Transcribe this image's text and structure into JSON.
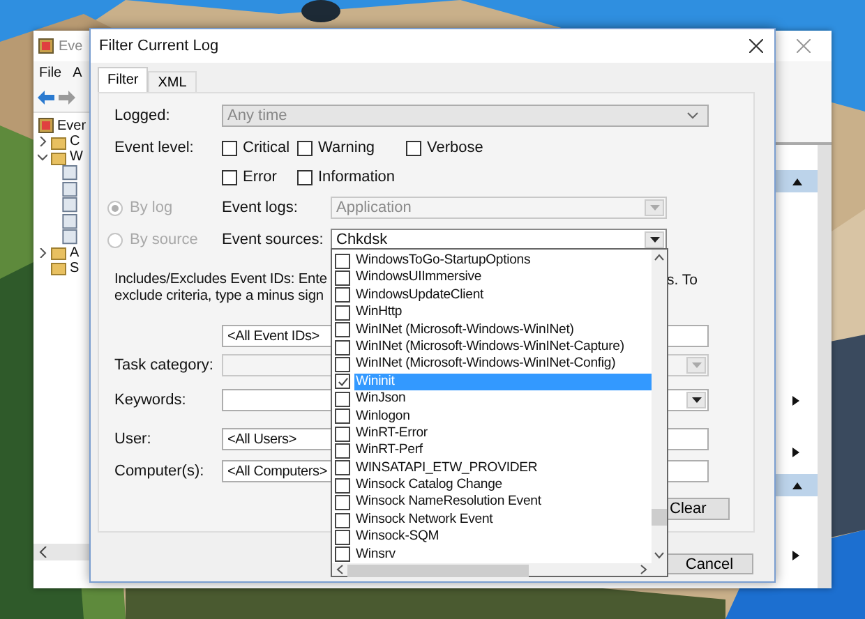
{
  "background_window": {
    "title": "Eve",
    "menu": [
      "File",
      "A"
    ],
    "tree": [
      {
        "label": "Ever",
        "children": [
          {
            "label": "C",
            "expanded": false
          },
          {
            "label": "W",
            "expanded": true
          },
          {
            "label": "A",
            "expanded": false
          },
          {
            "label": "S"
          }
        ]
      }
    ]
  },
  "dialog": {
    "title": "Filter Current Log",
    "tabs": [
      {
        "label": "Filter",
        "selected": true
      },
      {
        "label": "XML",
        "selected": false
      }
    ],
    "logged": {
      "label": "Logged:",
      "value": "Any time"
    },
    "event_level": {
      "label": "Event level:",
      "options": [
        {
          "label": "Critical",
          "checked": false
        },
        {
          "label": "Warning",
          "checked": false
        },
        {
          "label": "Verbose",
          "checked": false
        },
        {
          "label": "Error",
          "checked": false
        },
        {
          "label": "Information",
          "checked": false
        }
      ]
    },
    "source_mode": [
      {
        "label": "By log",
        "selected": true,
        "disabled": true
      },
      {
        "label": "By source",
        "selected": false,
        "disabled": true
      }
    ],
    "event_logs": {
      "label": "Event logs:",
      "value": "Application",
      "disabled": true
    },
    "event_sources": {
      "label": "Event sources:",
      "value": "Chkdsk",
      "expanded": true,
      "options": [
        {
          "label": "WindowsToGo-StartupOptions",
          "checked": false,
          "selected": false
        },
        {
          "label": "WindowsUIImmersive",
          "checked": false,
          "selected": false
        },
        {
          "label": "WindowsUpdateClient",
          "checked": false,
          "selected": false
        },
        {
          "label": "WinHttp",
          "checked": false,
          "selected": false
        },
        {
          "label": "WinINet (Microsoft-Windows-WinINet)",
          "checked": false,
          "selected": false
        },
        {
          "label": "WinINet (Microsoft-Windows-WinINet-Capture)",
          "checked": false,
          "selected": false
        },
        {
          "label": "WinINet (Microsoft-Windows-WinINet-Config)",
          "checked": false,
          "selected": false
        },
        {
          "label": "Wininit",
          "checked": true,
          "selected": true
        },
        {
          "label": "WinJson",
          "checked": false,
          "selected": false
        },
        {
          "label": "Winlogon",
          "checked": false,
          "selected": false
        },
        {
          "label": "WinRT-Error",
          "checked": false,
          "selected": false
        },
        {
          "label": "WinRT-Perf",
          "checked": false,
          "selected": false
        },
        {
          "label": "WINSATAPI_ETW_PROVIDER",
          "checked": false,
          "selected": false
        },
        {
          "label": "Winsock Catalog Change",
          "checked": false,
          "selected": false
        },
        {
          "label": "Winsock NameResolution Event",
          "checked": false,
          "selected": false
        },
        {
          "label": "Winsock Network Event",
          "checked": false,
          "selected": false
        },
        {
          "label": "Winsock-SQM",
          "checked": false,
          "selected": false
        },
        {
          "label": "Winsrv",
          "checked": false,
          "selected": false
        }
      ]
    },
    "ids_hint_left": [
      "Includes/Excludes Event IDs: Ente",
      "exclude criteria, type a minus sign"
    ],
    "ids_hint_right": "s. To",
    "event_ids": {
      "value": "<All Event IDs>"
    },
    "task_category": {
      "label": "Task category:",
      "disabled": true
    },
    "keywords": {
      "label": "Keywords:",
      "disabled": false
    },
    "user": {
      "label": "User:",
      "value": "<All Users>"
    },
    "computers": {
      "label": "Computer(s):",
      "value": "<All Computers>"
    },
    "clear_button": {
      "label": "Clear"
    },
    "footer_buttons": [
      {
        "label": "Cancel"
      }
    ]
  }
}
